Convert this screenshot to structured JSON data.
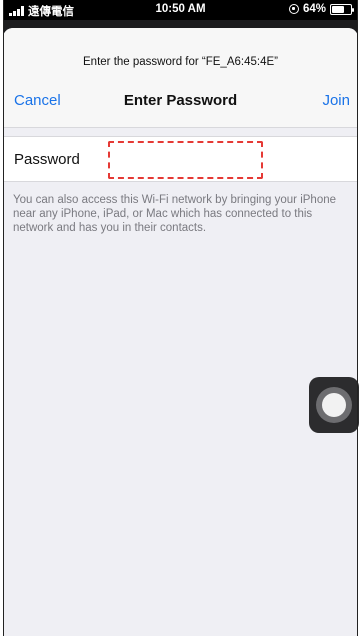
{
  "status_bar": {
    "carrier": "遠傳電信",
    "time": "10:50 AM",
    "battery_percent": "64%",
    "battery_level": 0.64,
    "icons": [
      "signal-icon",
      "rotation-lock-icon",
      "battery-icon"
    ]
  },
  "sheet": {
    "prompt": "Enter the password for “FE_A6:45:4E”",
    "title": "Enter Password",
    "cancel_label": "Cancel",
    "join_label": "Join"
  },
  "form": {
    "password_label": "Password",
    "password_value": "",
    "password_placeholder": ""
  },
  "footnote": "You can also access this Wi-Fi network by bringing your iPhone near any iPhone, iPad, or Mac which has connected to this network and has you in their contacts.",
  "colors": {
    "accent": "#1a73e8",
    "highlight": "#e53935",
    "background": "#efeff4"
  }
}
